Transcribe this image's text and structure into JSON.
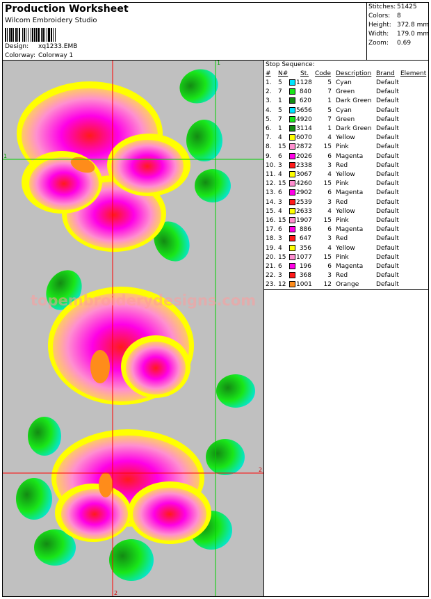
{
  "header": {
    "title": "Production Worksheet",
    "software": "Wilcom Embroidery Studio",
    "design_label": "Design:",
    "design_value": "xq1233.EMB",
    "colorway_label": "Colorway:",
    "colorway_value": "Colorway 1"
  },
  "stats": [
    {
      "label": "Stitches:",
      "value": "51425"
    },
    {
      "label": "Colors:",
      "value": "8"
    },
    {
      "label": "Height:",
      "value": "372.8 mm"
    },
    {
      "label": "Width:",
      "value": "179.0 mm"
    },
    {
      "label": "Zoom:",
      "value": "0.69"
    }
  ],
  "stop_sequence": {
    "title": "Stop Sequence:",
    "columns": [
      "#",
      "N#",
      "St.",
      "Code",
      "Description",
      "Brand",
      "Element"
    ],
    "rows": [
      {
        "idx": "1.",
        "n": "5",
        "st": "1128",
        "code": "5",
        "desc": "Cyan",
        "brand": "Default",
        "color": "#00e5ff"
      },
      {
        "idx": "2.",
        "n": "7",
        "st": "840",
        "code": "7",
        "desc": "Green",
        "brand": "Default",
        "color": "#19e619"
      },
      {
        "idx": "3.",
        "n": "1",
        "st": "620",
        "code": "1",
        "desc": "Dark Green",
        "brand": "Default",
        "color": "#138a13"
      },
      {
        "idx": "4.",
        "n": "5",
        "st": "5656",
        "code": "5",
        "desc": "Cyan",
        "brand": "Default",
        "color": "#00e5ff"
      },
      {
        "idx": "5.",
        "n": "7",
        "st": "4920",
        "code": "7",
        "desc": "Green",
        "brand": "Default",
        "color": "#19e619"
      },
      {
        "idx": "6.",
        "n": "1",
        "st": "3114",
        "code": "1",
        "desc": "Dark Green",
        "brand": "Default",
        "color": "#138a13"
      },
      {
        "idx": "7.",
        "n": "4",
        "st": "6070",
        "code": "4",
        "desc": "Yellow",
        "brand": "Default",
        "color": "#ffff00"
      },
      {
        "idx": "8.",
        "n": "15",
        "st": "2872",
        "code": "15",
        "desc": "Pink",
        "brand": "Default",
        "color": "#ff8fd0"
      },
      {
        "idx": "9.",
        "n": "6",
        "st": "2026",
        "code": "6",
        "desc": "Magenta",
        "brand": "Default",
        "color": "#ff00e6"
      },
      {
        "idx": "10.",
        "n": "3",
        "st": "2338",
        "code": "3",
        "desc": "Red",
        "brand": "Default",
        "color": "#ff1a1a"
      },
      {
        "idx": "11.",
        "n": "4",
        "st": "3067",
        "code": "4",
        "desc": "Yellow",
        "brand": "Default",
        "color": "#ffff00"
      },
      {
        "idx": "12.",
        "n": "15",
        "st": "4260",
        "code": "15",
        "desc": "Pink",
        "brand": "Default",
        "color": "#ff8fd0"
      },
      {
        "idx": "13.",
        "n": "6",
        "st": "2902",
        "code": "6",
        "desc": "Magenta",
        "brand": "Default",
        "color": "#ff00e6"
      },
      {
        "idx": "14.",
        "n": "3",
        "st": "2539",
        "code": "3",
        "desc": "Red",
        "brand": "Default",
        "color": "#ff1a1a"
      },
      {
        "idx": "15.",
        "n": "4",
        "st": "2633",
        "code": "4",
        "desc": "Yellow",
        "brand": "Default",
        "color": "#ffff00"
      },
      {
        "idx": "16.",
        "n": "15",
        "st": "1907",
        "code": "15",
        "desc": "Pink",
        "brand": "Default",
        "color": "#ff8fd0"
      },
      {
        "idx": "17.",
        "n": "6",
        "st": "886",
        "code": "6",
        "desc": "Magenta",
        "brand": "Default",
        "color": "#ff00e6"
      },
      {
        "idx": "18.",
        "n": "3",
        "st": "647",
        "code": "3",
        "desc": "Red",
        "brand": "Default",
        "color": "#ff1a1a"
      },
      {
        "idx": "19.",
        "n": "4",
        "st": "356",
        "code": "4",
        "desc": "Yellow",
        "brand": "Default",
        "color": "#ffff00"
      },
      {
        "idx": "20.",
        "n": "15",
        "st": "1077",
        "code": "15",
        "desc": "Pink",
        "brand": "Default",
        "color": "#ff8fd0"
      },
      {
        "idx": "21.",
        "n": "6",
        "st": "196",
        "code": "6",
        "desc": "Magenta",
        "brand": "Default",
        "color": "#ff00e6"
      },
      {
        "idx": "22.",
        "n": "3",
        "st": "368",
        "code": "3",
        "desc": "Red",
        "brand": "Default",
        "color": "#ff1a1a"
      },
      {
        "idx": "23.",
        "n": "12",
        "st": "1001",
        "code": "12",
        "desc": "Orange",
        "brand": "Default",
        "color": "#ff8c1a"
      }
    ]
  },
  "canvas": {
    "watermark": "topembroiderydesigns.com",
    "guide_labels": {
      "top": "1",
      "left": "1",
      "right": "2",
      "bottom": "2"
    },
    "colors": {
      "background": "#c0c0c0",
      "guide_red": "#ff0000",
      "guide_green": "#00d000"
    }
  }
}
